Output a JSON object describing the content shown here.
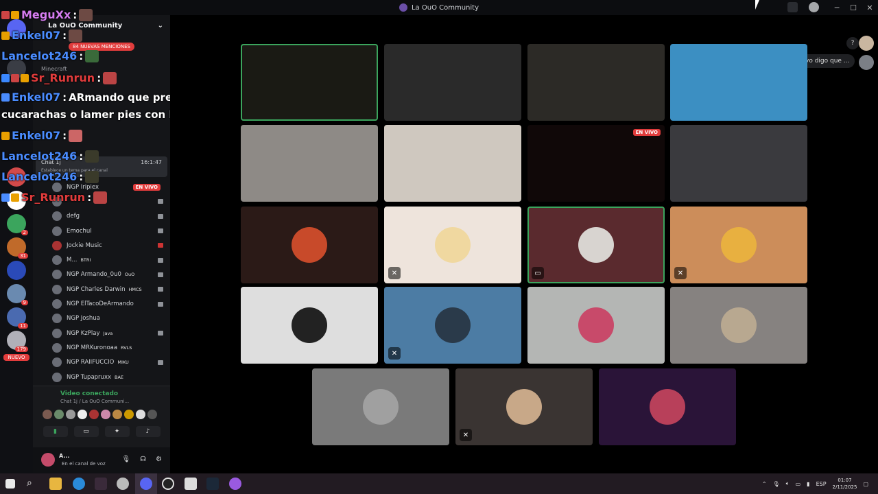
{
  "window": {
    "title": "La OuO Community"
  },
  "server": {
    "name": "La OuO Community",
    "mentions": "84 NUEVAS MENCIONES"
  },
  "categories": [
    "Minecraft"
  ],
  "live_channel": {
    "name": "Chat 1j",
    "time": "16:1:47",
    "sub": "Establece un tema para el canal",
    "badge": "EN VIVO"
  },
  "members": [
    {
      "name": "NGP Iripiex",
      "tag": "",
      "live": "EN VIVO"
    },
    {
      "name": "",
      "tag": ""
    },
    {
      "name": "defg",
      "tag": ""
    },
    {
      "name": "Emochul",
      "tag": ""
    },
    {
      "name": "Jockie Music",
      "tag": ""
    },
    {
      "name": "M...",
      "tag": "BTRI"
    },
    {
      "name": "NGP Armando_0u0",
      "tag": "OuO"
    },
    {
      "name": "NGP Charles Darwin",
      "tag": "HMCS"
    },
    {
      "name": "NGP ElTacoDeArmando",
      "tag": ""
    },
    {
      "name": "NGP Joshua",
      "tag": ""
    },
    {
      "name": "NGP KzPlay",
      "tag": "Java"
    },
    {
      "name": "NGP MRKuronoaa",
      "tag": "RVLS"
    },
    {
      "name": "NGP RAIIFUCCIO",
      "tag": "MIKU"
    },
    {
      "name": "NGP Tupapruxx",
      "tag": "BAE"
    }
  ],
  "voice_panel": {
    "status": "Video conectado",
    "channel": "Chat 1j / La OuO Communi..."
  },
  "user": {
    "name": "A...",
    "status": "En el canal de voz"
  },
  "guild_badges": [
    "2",
    "31",
    "9",
    "11",
    "179"
  ],
  "guild_new": "NUEVO",
  "overlay_chat": [
    {
      "user": "MeguXx",
      "color": "#d57cf0",
      "text": ""
    },
    {
      "user": "Enkel07",
      "color": "#4a8cff",
      "text": ""
    },
    {
      "user": "Lancelot246",
      "color": "#4a8cff",
      "text": ""
    },
    {
      "user": "Sr_Runrun",
      "color": "#e23c3c",
      "text": ""
    },
    {
      "user": "Enkel07",
      "color": "#4a8cff",
      "text": "ARmando que prefieres comer"
    },
    {
      "user": "",
      "color": "#ffffff",
      "text": "cucarachas o lamer pies con hongos"
    },
    {
      "user": "Enkel07",
      "color": "#4a8cff",
      "text": ""
    },
    {
      "user": "Lancelot246",
      "color": "#4a8cff",
      "text": ""
    },
    {
      "user": "Lancelot246",
      "color": "#4a8cff",
      "text": ""
    },
    {
      "user": "Sr_Runrun",
      "color": "#e23c3c",
      "text": ""
    }
  ],
  "stage": {
    "live_badge": "EN VIVO",
    "help": "?",
    "bubble": "yo digo que ..."
  },
  "tiles_colors": [
    "#1a1a14",
    "#2a2a2a",
    "#2c2a26",
    "#3c8fc2",
    "#8e8a86",
    "#cfc8bf",
    "#100808",
    "#3a3a3e",
    "#2b1a17",
    "#eee4dc",
    "#5a2a2e",
    "#cc8d5a",
    "#dedede",
    "#4c7ca4",
    "#b4b6b4",
    "#868280",
    "#7a7a7a",
    "#3a3432",
    "#2a1438"
  ],
  "taskbar": {
    "lang": "ESP",
    "time": "01:07",
    "date": "2/11/2025"
  }
}
